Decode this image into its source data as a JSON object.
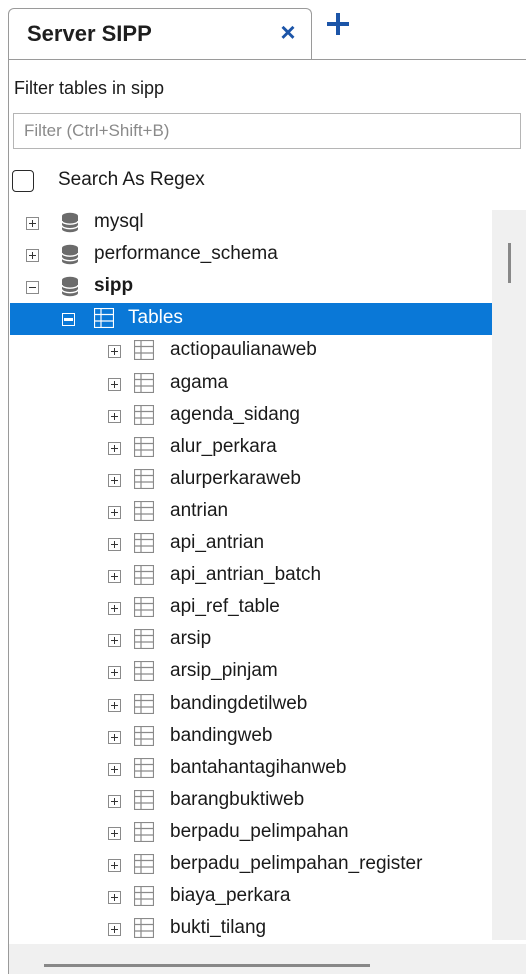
{
  "tab": {
    "title": "Server SIPP",
    "close_glyph": "×",
    "add_icon": "plus-icon"
  },
  "filter": {
    "label": "Filter tables in sipp",
    "placeholder": "Filter (Ctrl+Shift+B)",
    "value": ""
  },
  "regex": {
    "label": "Search As Regex",
    "checked": false
  },
  "tree": {
    "databases": [
      {
        "name": "mysql",
        "expanded": false
      },
      {
        "name": "performance_schema",
        "expanded": false
      },
      {
        "name": "sipp",
        "expanded": true
      }
    ],
    "tables_node": {
      "label": "Tables",
      "selected": true
    },
    "tables": [
      "actiopaulianaweb",
      "agama",
      "agenda_sidang",
      "alur_perkara",
      "alurperkaraweb",
      "antrian",
      "api_antrian",
      "api_antrian_batch",
      "api_ref_table",
      "arsip",
      "arsip_pinjam",
      "bandingdetilweb",
      "bandingweb",
      "bantahantagihanweb",
      "barangbuktiweb",
      "berpadu_pelimpahan",
      "berpadu_pelimpahan_register",
      "biaya_perkara",
      "bukti_tilang"
    ]
  },
  "colors": {
    "accent": "#1c55a8",
    "selection": "#0a78d7",
    "db_icon": "#6b6b6b",
    "table_icon": "#8a8a8a"
  }
}
